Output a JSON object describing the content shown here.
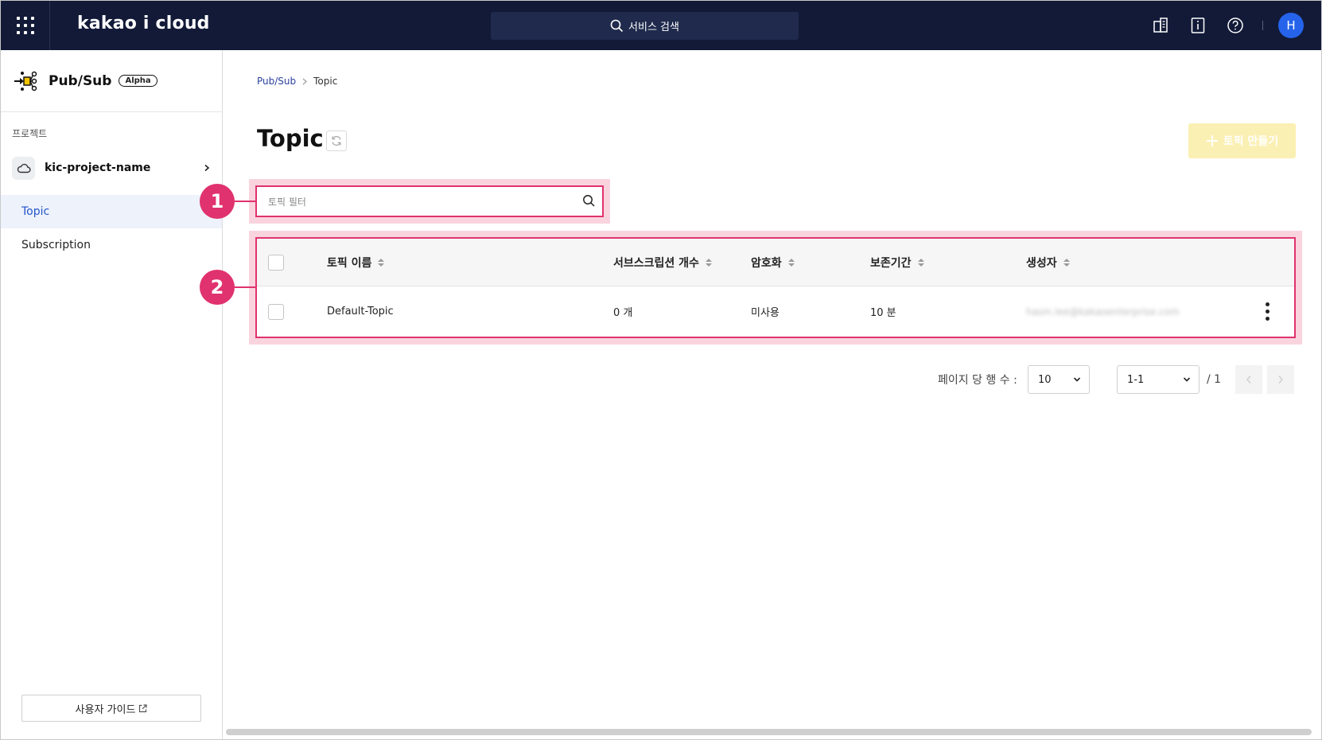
{
  "topbar": {
    "logo": "kakao i cloud",
    "search_placeholder": "서비스 검색",
    "icons": [
      "grid-menu-icon",
      "building-icon",
      "document-info-icon",
      "help-icon"
    ],
    "avatar_initial": "H",
    "avatar_color": "#2563eb",
    "bar_color": "#121a38"
  },
  "sidebar": {
    "service_name": "Pub/Sub",
    "service_badge": "Alpha",
    "project_label": "프로젝트",
    "project_name": "kic-project-name",
    "items": [
      {
        "label": "Topic",
        "active": true
      },
      {
        "label": "Subscription",
        "active": false
      }
    ],
    "guide_label": "사용자 가이드"
  },
  "breadcrumb": {
    "parent": "Pub/Sub",
    "current": "Topic"
  },
  "page": {
    "title": "Topic",
    "create_label": "토픽 만들기",
    "filter_placeholder": "토픽 필터"
  },
  "markers": [
    "1",
    "2"
  ],
  "accent_color": "#e0326e",
  "table": {
    "headers": [
      "토픽 이름",
      "서브스크립션 개수",
      "암호화",
      "보존기간",
      "생성자"
    ],
    "rows": [
      {
        "name": "Default-Topic",
        "subscriptions": "0 개",
        "encryption": "미사용",
        "retention": "10 분",
        "creator": "hasin.lee@kakaoenterprise.com"
      }
    ]
  },
  "pagination": {
    "rows_per_page_label": "페이지 당 행 수 :",
    "rows_per_page": "10",
    "range": "1-1",
    "total_pages": "/ 1"
  }
}
